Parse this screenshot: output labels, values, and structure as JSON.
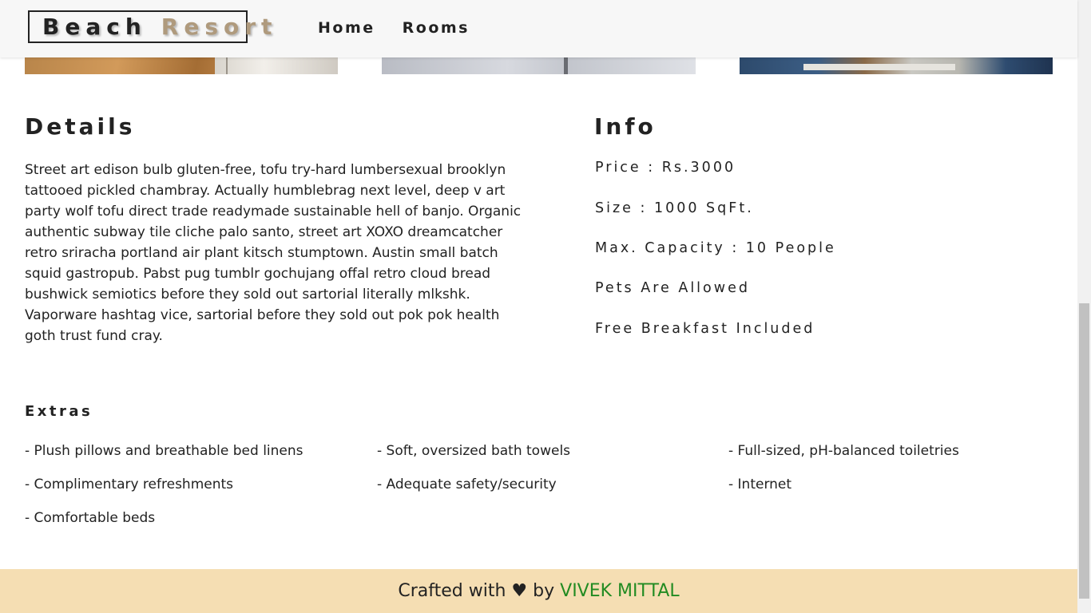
{
  "navbar": {
    "logo_part1": "Beach",
    "logo_part2": "Resort",
    "links": [
      "Home",
      "Rooms"
    ]
  },
  "details": {
    "title": "Details",
    "description": "Street art edison bulb gluten-free, tofu try-hard lumbersexual brooklyn tattooed pickled chambray. Actually humblebrag next level, deep v art party wolf tofu direct trade readymade sustainable hell of banjo. Organic authentic subway tile cliche palo santo, street art XOXO dreamcatcher retro sriracha portland air plant kitsch stumptown. Austin small batch squid gastropub. Pabst pug tumblr gochujang offal retro cloud bread bushwick semiotics before they sold out sartorial literally mlkshk. Vaporware hashtag vice, sartorial before they sold out pok pok health goth trust fund cray."
  },
  "info": {
    "title": "Info",
    "price": "Price : Rs.3000",
    "size": "Size : 1000 SqFt.",
    "capacity": "Max. Capacity : 10 People",
    "pets": "Pets Are Allowed",
    "breakfast": "Free Breakfast Included"
  },
  "extras": {
    "title": "Extras",
    "items": [
      "- Plush pillows and breathable bed linens",
      "- Soft, oversized bath towels",
      "- Full-sized, pH-balanced toiletries",
      "- Complimentary refreshments",
      "- Adequate safety/security",
      "- Internet",
      "- Comfortable beds"
    ]
  },
  "footer": {
    "prefix": "Crafted with",
    "heart": "♥",
    "by": "by",
    "author": "VIVEK MITTAL"
  },
  "colors": {
    "accent": "#af9a7d",
    "footer_bg": "#f5deb3",
    "author": "#228b22",
    "text": "#222222"
  }
}
